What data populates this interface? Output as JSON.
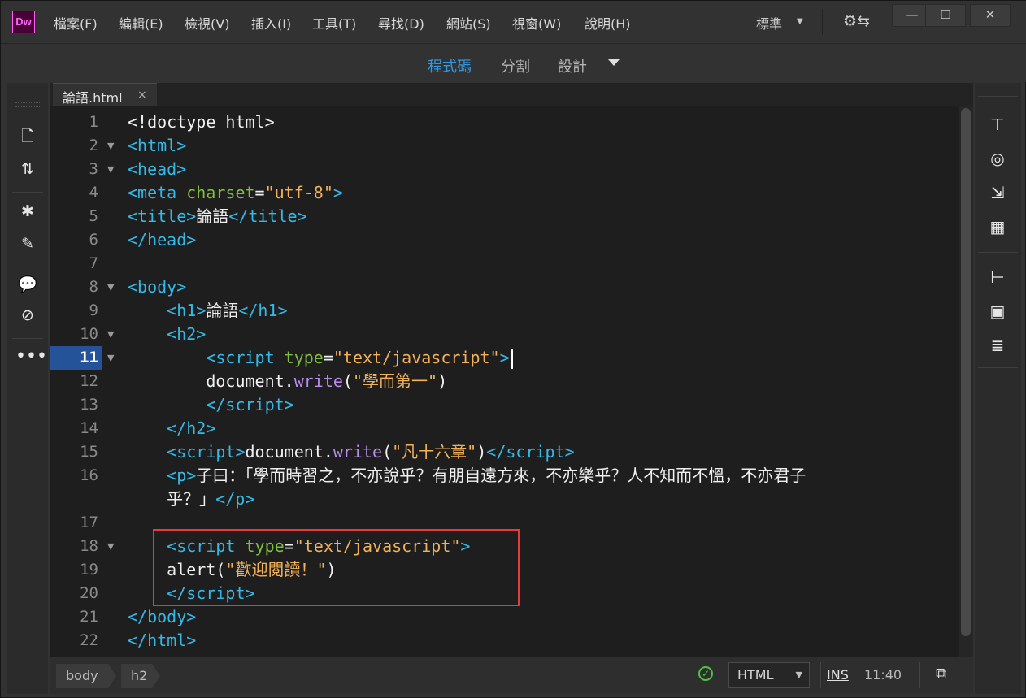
{
  "app": {
    "logo": "Dw",
    "workspace": "標準",
    "colors": {
      "accent": "#2f9be8",
      "highlight_box": "#e8393c"
    }
  },
  "menu": [
    {
      "label": "檔案(F)"
    },
    {
      "label": "編輯(E)"
    },
    {
      "label": "檢視(V)"
    },
    {
      "label": "插入(I)"
    },
    {
      "label": "工具(T)"
    },
    {
      "label": "尋找(D)"
    },
    {
      "label": "網站(S)"
    },
    {
      "label": "視窗(W)"
    },
    {
      "label": "說明(H)"
    }
  ],
  "window_controls": {
    "minimize": "—",
    "maximize": "☐",
    "close": "✕"
  },
  "views": {
    "code": "程式碼",
    "split": "分割",
    "design": "設計",
    "active": "code"
  },
  "tab": {
    "filename": "論語.html",
    "close": "×"
  },
  "editor": {
    "active_line": 11,
    "lines": [
      "1",
      "2",
      "3",
      "4",
      "5",
      "6",
      "7",
      "8",
      "9",
      "10",
      "11",
      "12",
      "13",
      "14",
      "15",
      "16",
      "",
      "17",
      "18",
      "19",
      "20",
      "21",
      "22"
    ]
  },
  "left_tools": [
    "new-file-icon",
    "file-transfer-icon",
    "expand-collapse-icon",
    "format-source-icon",
    "comment-icon",
    "remove-comment-icon",
    "more-icon"
  ],
  "right_tools": [
    "files-icon",
    "creative-cloud-icon",
    "insert-icon",
    "assets-icon",
    "dom-icon",
    "snippets-icon",
    "css-designer-icon"
  ],
  "status": {
    "breadcrumbs": [
      "body",
      "h2"
    ],
    "language": "HTML",
    "mode": "INS",
    "cursor": "11:40",
    "lint_ok": "✓"
  }
}
